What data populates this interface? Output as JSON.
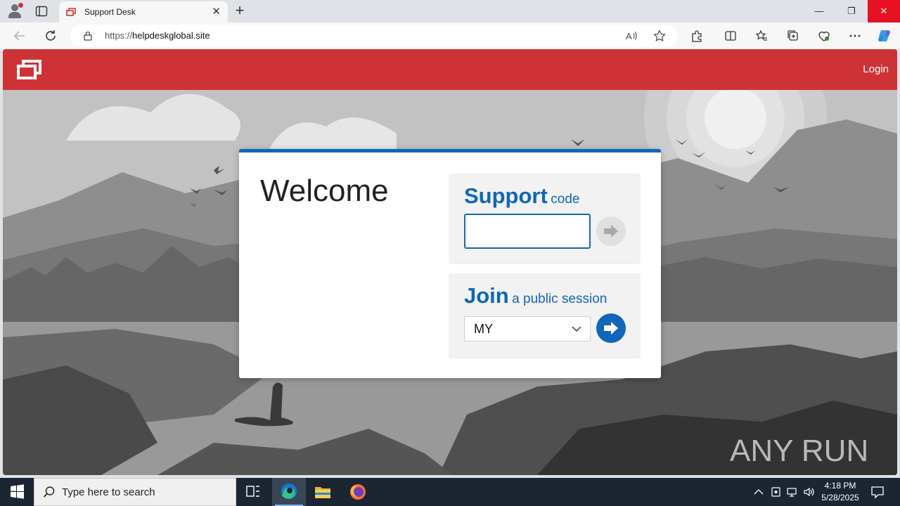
{
  "browser": {
    "tab_title": "Support Desk",
    "tab_close": "✕",
    "new_tab": "+",
    "url_prefix": "https://",
    "url_host": "helpdeskglobal.site",
    "window_controls": {
      "minimize": "—",
      "restore": "❐",
      "close": "✕"
    }
  },
  "page": {
    "header": {
      "login_label": "Login",
      "brand_color": "#cf3234"
    },
    "dialog": {
      "welcome": "Welcome",
      "support": {
        "title_big": "Support",
        "title_small": "code",
        "input_value": ""
      },
      "join": {
        "title_big": "Join",
        "title_small": "a public session",
        "selected_option": "MY"
      }
    },
    "watermark": "ANY RUN"
  },
  "taskbar": {
    "search_placeholder": "Type here to search",
    "time": "4:18 PM",
    "date": "5/28/2025"
  },
  "icons": {
    "tabstrip": [
      "profile-icon",
      "tab-actions-icon",
      "favicon-icon"
    ],
    "toolbar": [
      "back-icon",
      "refresh-icon",
      "lock-icon",
      "read-aloud-icon",
      "favorite-star-icon",
      "extensions-icon",
      "split-screen-icon",
      "favorites-icon",
      "collections-icon",
      "browser-essentials-icon",
      "more-icon",
      "copilot-icon"
    ],
    "taskbar": [
      "windows-start-icon",
      "search-icon",
      "task-view-icon",
      "edge-icon",
      "file-explorer-icon",
      "firefox-icon",
      "tray-chevron-icon",
      "meet-now-icon",
      "network-icon",
      "volume-icon",
      "notification-icon"
    ]
  },
  "colors": {
    "accent_blue": "#1166bb",
    "header_red": "#cf3234",
    "taskbar": "#1c2532"
  }
}
